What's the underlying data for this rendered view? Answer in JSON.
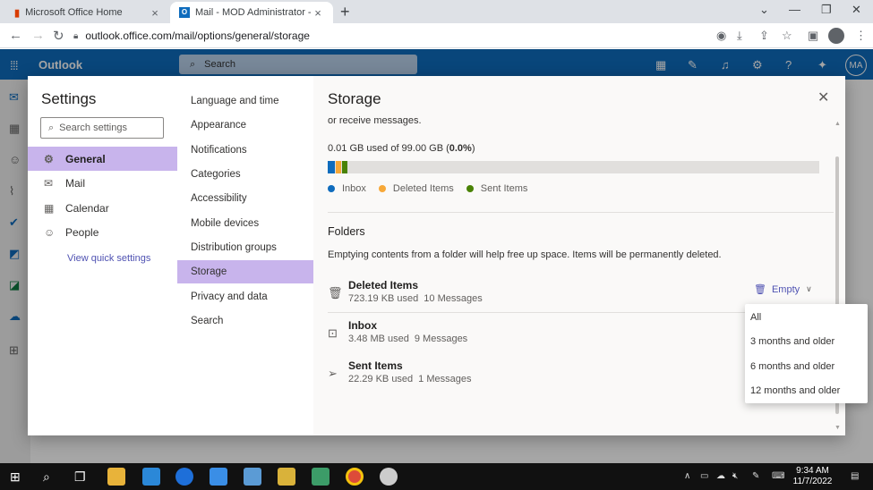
{
  "browser": {
    "tabs": [
      {
        "title": "Microsoft Office Home",
        "icon": "office-icon"
      },
      {
        "title": "Mail - MOD Administrator - Outl",
        "icon": "outlook-icon"
      }
    ],
    "url": "outlook.office.com/mail/options/general/storage"
  },
  "outlook": {
    "brand": "Outlook",
    "search_placeholder": "Search",
    "avatar": "MA"
  },
  "settings": {
    "title": "Settings",
    "search_placeholder": "Search settings",
    "categories": [
      {
        "label": "General",
        "icon": "gear-icon"
      },
      {
        "label": "Mail",
        "icon": "mail-icon"
      },
      {
        "label": "Calendar",
        "icon": "calendar-icon"
      },
      {
        "label": "People",
        "icon": "people-icon"
      }
    ],
    "quick_link": "View quick settings",
    "subcategories": [
      "Language and time",
      "Appearance",
      "Notifications",
      "Categories",
      "Accessibility",
      "Mobile devices",
      "Distribution groups",
      "Storage",
      "Privacy and data",
      "Search"
    ]
  },
  "storage": {
    "title": "Storage",
    "cut_text": "or receive messages.",
    "usage_prefix": "0.01 GB used of 99.00 GB (",
    "usage_percent": "0.0%",
    "usage_suffix": ")",
    "usage_fraction": 0.0,
    "legend": [
      {
        "label": "Inbox",
        "color": "#0f6cbd"
      },
      {
        "label": "Deleted Items",
        "color": "#f7a838"
      },
      {
        "label": "Sent Items",
        "color": "#498205"
      }
    ],
    "folders_heading": "Folders",
    "folders_desc": "Emptying contents from a folder will help free up space. Items will be permanently deleted.",
    "folders": [
      {
        "name": "Deleted Items",
        "size": "723.19 KB used",
        "count": "10 Messages",
        "icon": "trash-icon"
      },
      {
        "name": "Inbox",
        "size": "3.48 MB used",
        "count": "9 Messages",
        "icon": "inbox-icon"
      },
      {
        "name": "Sent Items",
        "size": "22.29 KB used",
        "count": "1 Messages",
        "icon": "send-icon"
      }
    ],
    "empty_label": "Empty",
    "empty_options": [
      "All",
      "3 months and older",
      "6 months and older",
      "12 months and older"
    ]
  },
  "taskbar": {
    "time": "9:34 AM",
    "date": "11/7/2022"
  }
}
